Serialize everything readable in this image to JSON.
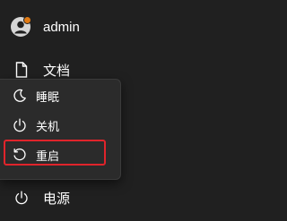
{
  "user": {
    "name": "admin",
    "status_color": "#e07a14"
  },
  "pinned": {
    "documents_label": "文档",
    "documents_icon": "document-icon"
  },
  "power_menu": {
    "items": [
      {
        "label": "睡眠",
        "icon": "sleep-icon"
      },
      {
        "label": "关机",
        "icon": "power-icon"
      },
      {
        "label": "重启",
        "icon": "restart-icon"
      }
    ],
    "highlight_color": "#e0242b"
  },
  "footer": {
    "power_label": "电源",
    "power_icon": "power-icon"
  }
}
